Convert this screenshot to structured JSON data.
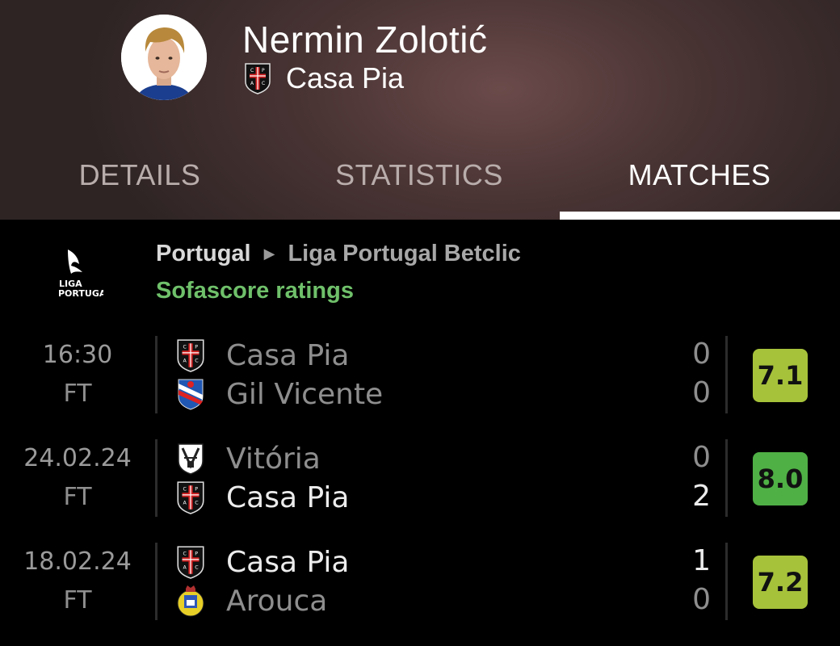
{
  "player": {
    "name": "Nermin Zolotić",
    "team": "Casa Pia"
  },
  "tabs": [
    {
      "label": "DETAILS",
      "active": false
    },
    {
      "label": "STATISTICS",
      "active": false
    },
    {
      "label": "MATCHES",
      "active": true
    }
  ],
  "competition": {
    "country": "Portugal",
    "league": "Liga Portugal Betclic",
    "logo_text_1": "LIGA",
    "logo_text_2": "PORTUGAL",
    "ratings_label": "Sofascore ratings"
  },
  "matches": [
    {
      "date": "16:30",
      "status": "FT",
      "home": {
        "name": "Casa Pia",
        "score": "0",
        "crest": "casa-pia-crest"
      },
      "away": {
        "name": "Gil Vicente",
        "score": "0",
        "crest": "gil-vicente-crest"
      },
      "rating": "7.1",
      "rating_color": "#a6c23a"
    },
    {
      "date": "24.02.24",
      "status": "FT",
      "home": {
        "name": "Vitória",
        "score": "0",
        "crest": "vitoria-crest"
      },
      "away": {
        "name": "Casa Pia",
        "score": "2",
        "crest": "casa-pia-crest"
      },
      "rating": "8.0",
      "rating_color": "#4fb045"
    },
    {
      "date": "18.02.24",
      "status": "FT",
      "home": {
        "name": "Casa Pia",
        "score": "1",
        "crest": "casa-pia-crest"
      },
      "away": {
        "name": "Arouca",
        "score": "0",
        "crest": "arouca-crest"
      },
      "rating": "7.2",
      "rating_color": "#a6c23a"
    }
  ],
  "colors": {
    "active_tab": "#ffffff",
    "inactive_tab": "#b9adab",
    "ratings_label": "#6fc06a"
  }
}
